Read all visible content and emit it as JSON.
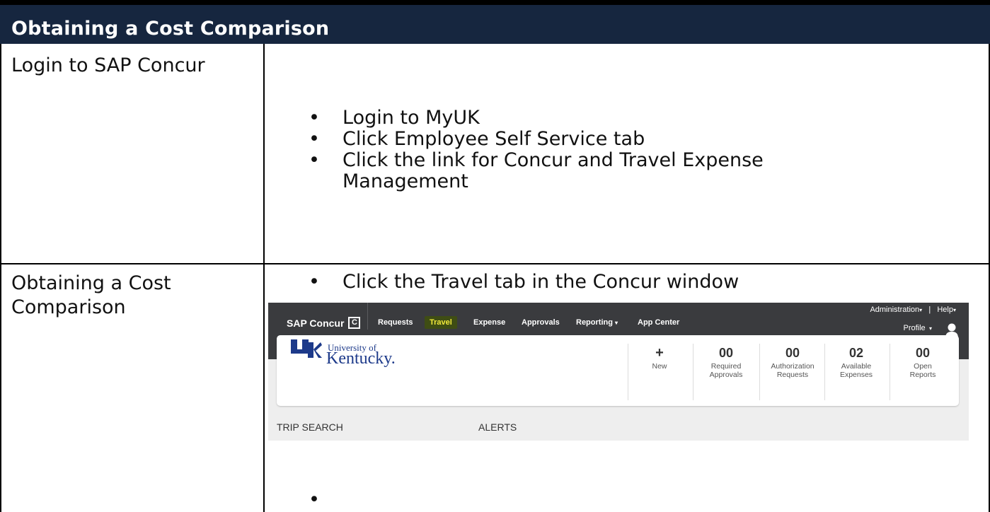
{
  "document": {
    "title": "Obtaining a Cost Comparison",
    "rows": [
      {
        "label": "Login to SAP Concur",
        "bullets": [
          "Login to MyUK",
          "Click Employee Self Service tab",
          "Click the link for Concur and Travel Expense Management"
        ]
      },
      {
        "label": "Obtaining a Cost Comparison",
        "bullets": [
          "Click the Travel tab in the Concur window",
          ""
        ]
      }
    ]
  },
  "concur": {
    "brand": "SAP Concur",
    "brand_icon": "concur-c-icon",
    "nav": [
      {
        "label": "Requests",
        "active": false
      },
      {
        "label": "Travel",
        "active": true
      },
      {
        "label": "Expense",
        "active": false
      },
      {
        "label": "Approvals",
        "active": false
      },
      {
        "label": "Reporting",
        "active": false
      },
      {
        "label": "App Center",
        "active": false
      }
    ],
    "administration": "Administration",
    "separator": "|",
    "help": "Help",
    "profile": "Profile",
    "logo": {
      "top": "University of",
      "main": "Kentucky."
    },
    "new_symbol": "+",
    "new_label": "New",
    "stats": [
      {
        "num": "00",
        "label_1": "Required",
        "label_2": "Approvals"
      },
      {
        "num": "00",
        "label_1": "Authorization",
        "label_2": "Requests"
      },
      {
        "num": "02",
        "label_1": "Available",
        "label_2": "Expenses"
      },
      {
        "num": "00",
        "label_1": "Open",
        "label_2": "Reports"
      }
    ],
    "trip_search": "TRIP SEARCH",
    "alerts": "ALERTS",
    "colors": {
      "nav_bg": "#3a3b3e",
      "active_tab_bg": "#3f4d14",
      "active_tab_text": "#f2ea3a",
      "uk_blue": "#1d3a8a"
    }
  }
}
